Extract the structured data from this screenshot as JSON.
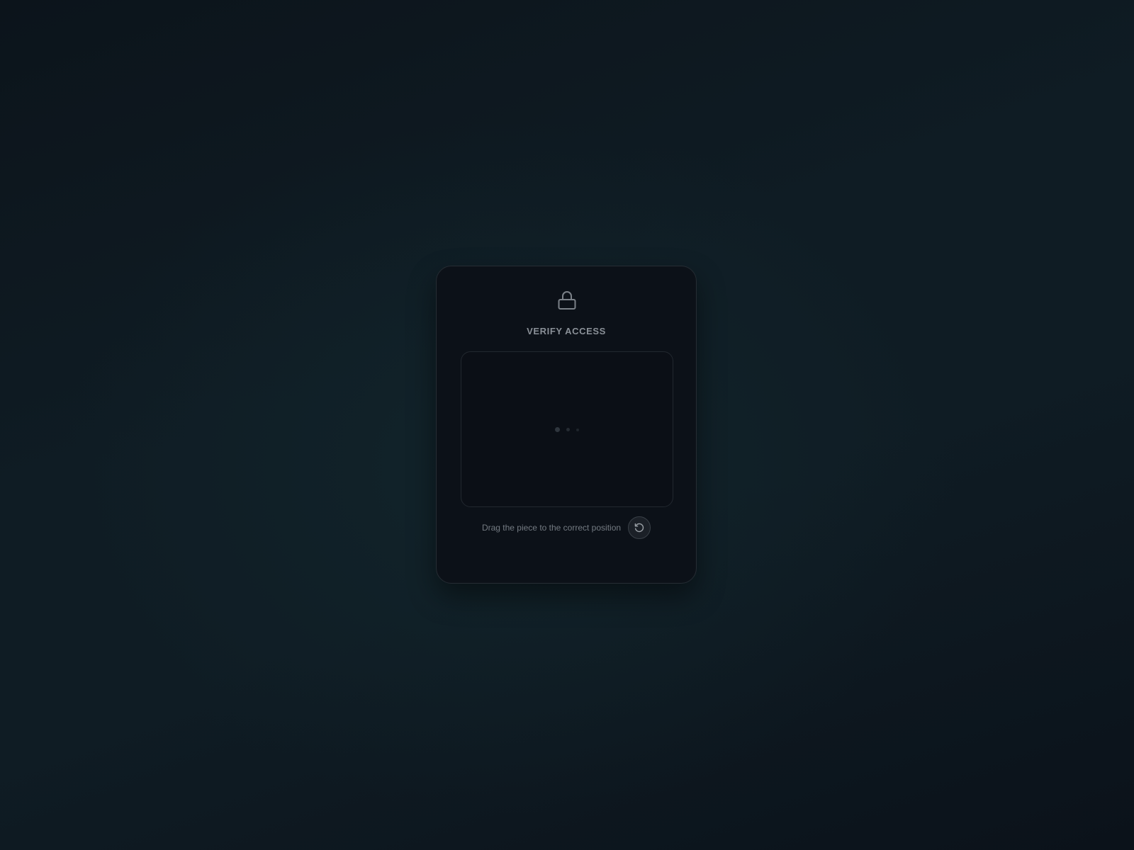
{
  "card": {
    "icon": "lock-icon",
    "title": "VERIFY ACCESS"
  },
  "puzzle": {
    "loading_indicator": "loading-dots"
  },
  "footer": {
    "hint": "Drag the piece to the correct position",
    "refresh_icon": "refresh-icon"
  }
}
